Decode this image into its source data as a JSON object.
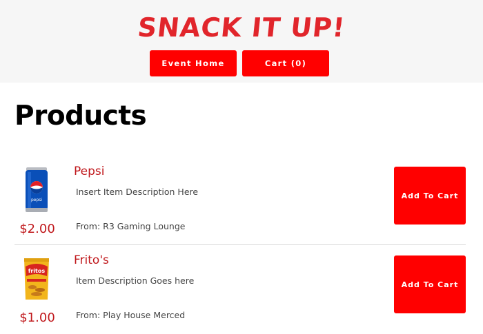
{
  "header": {
    "brand": "SNACK IT UP!",
    "nav": {
      "event_home": "Event Home",
      "cart": "Cart (0)"
    }
  },
  "page": {
    "title": "Products"
  },
  "products": [
    {
      "name": "Pepsi",
      "description": "Insert Item Description Here",
      "from": "From: R3 Gaming Lounge",
      "price": "$2.00",
      "button": "Add To Cart",
      "icon": "pepsi-can-image"
    },
    {
      "name": "Frito's",
      "description": "Item Description Goes here",
      "from": "From: Play House Merced",
      "price": "$1.00",
      "button": "Add To Cart",
      "icon": "fritos-bag-image"
    }
  ],
  "colors": {
    "accent": "#ff0000",
    "brand": "#e1252b",
    "text_red": "#c0181c"
  }
}
